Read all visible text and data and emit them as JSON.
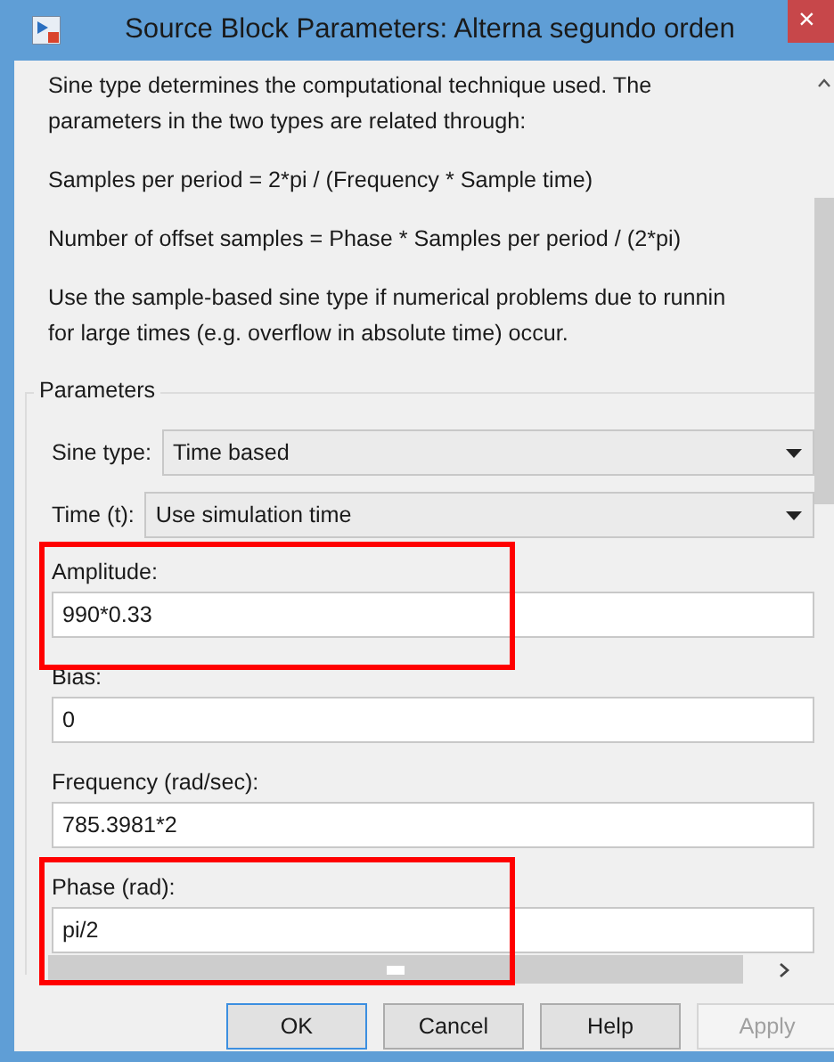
{
  "window": {
    "title": "Source Block Parameters: Alterna segundo orden",
    "close": "×"
  },
  "description": [
    [
      "Sine type determines the computational technique used. The",
      "parameters in the two types are related through:"
    ],
    [
      "Samples per period = 2*pi / (Frequency * Sample time)"
    ],
    [
      "Number of offset samples = Phase * Samples per period / (2*pi)"
    ],
    [
      "Use the sample-based sine type if numerical problems due to runnin",
      "for large times (e.g. overflow in absolute time) occur."
    ]
  ],
  "parameters": {
    "title": "Parameters",
    "fields": [
      {
        "kind": "dropdown",
        "label": "Sine type:",
        "value": "Time based",
        "highlighted": false
      },
      {
        "kind": "dropdown",
        "label": "Time (t):",
        "value": "Use simulation time",
        "highlighted": false
      },
      {
        "kind": "text",
        "label": "Amplitude:",
        "value": "990*0.33",
        "highlighted": true
      },
      {
        "kind": "text",
        "label": "Bias:",
        "value": "0",
        "highlighted": false
      },
      {
        "kind": "text",
        "label": "Frequency (rad/sec):",
        "value": "785.3981*2",
        "highlighted": false
      },
      {
        "kind": "text",
        "label": "Phase (rad):",
        "value": "pi/2",
        "highlighted": true
      }
    ]
  },
  "buttons": [
    {
      "label": "OK",
      "default": true,
      "disabled": false
    },
    {
      "label": "Cancel",
      "default": false,
      "disabled": false
    },
    {
      "label": "Help",
      "default": false,
      "disabled": false
    },
    {
      "label": "Apply",
      "default": false,
      "disabled": true
    }
  ]
}
